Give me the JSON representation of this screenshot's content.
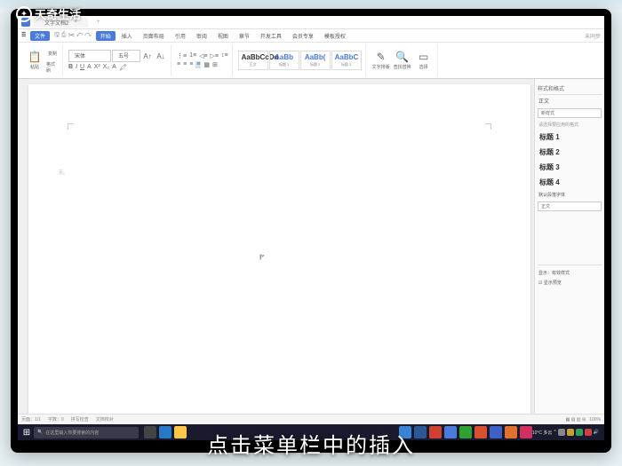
{
  "watermark": "天奇生活",
  "titlebar": {
    "tab_name": "文字文档2",
    "tab_add": "+"
  },
  "menubar": {
    "file": "文件",
    "items": [
      "开始",
      "插入",
      "页面布局",
      "引用",
      "审阅",
      "视图",
      "章节",
      "开发工具",
      "会员专享",
      "模板授权"
    ],
    "active_index": 0,
    "right": "未同步"
  },
  "ribbon": {
    "paste": "粘贴",
    "copy": "复制",
    "cut": "格式刷",
    "font_name": "宋体",
    "font_size": "五号",
    "styles": [
      {
        "sample": "AaBbCcDd",
        "label": "正文"
      },
      {
        "sample": "AaBb",
        "label": "标题 1"
      },
      {
        "sample": "AaBb(",
        "label": "标题 2"
      },
      {
        "sample": "AaBbC",
        "label": "标题 3"
      }
    ],
    "style_menu": "文字排版",
    "search_menu": "查找替换",
    "select_menu": "选择"
  },
  "page": {
    "number_marker": "页。",
    "cursor_text": "I"
  },
  "side_panel": {
    "title": "样式和格式",
    "current": "正文",
    "new_style": "新样式",
    "hint": "请选择要应用的格式",
    "headings": [
      "标题 1",
      "标题 2",
      "标题 3",
      "标题 4"
    ],
    "default": "默认段落字体",
    "body": "正文",
    "footer_label": "显示：有效样式",
    "checkbox": "显示预览"
  },
  "statusbar": {
    "left": [
      "页面：1/1",
      "字数：0",
      "拼写检查",
      "文档校对"
    ],
    "right": "100%"
  },
  "taskbar": {
    "search_placeholder": "在这里输入你要搜索的内容",
    "weather": "10°C 多云",
    "time": ""
  },
  "caption": "点击菜单栏中的插入"
}
